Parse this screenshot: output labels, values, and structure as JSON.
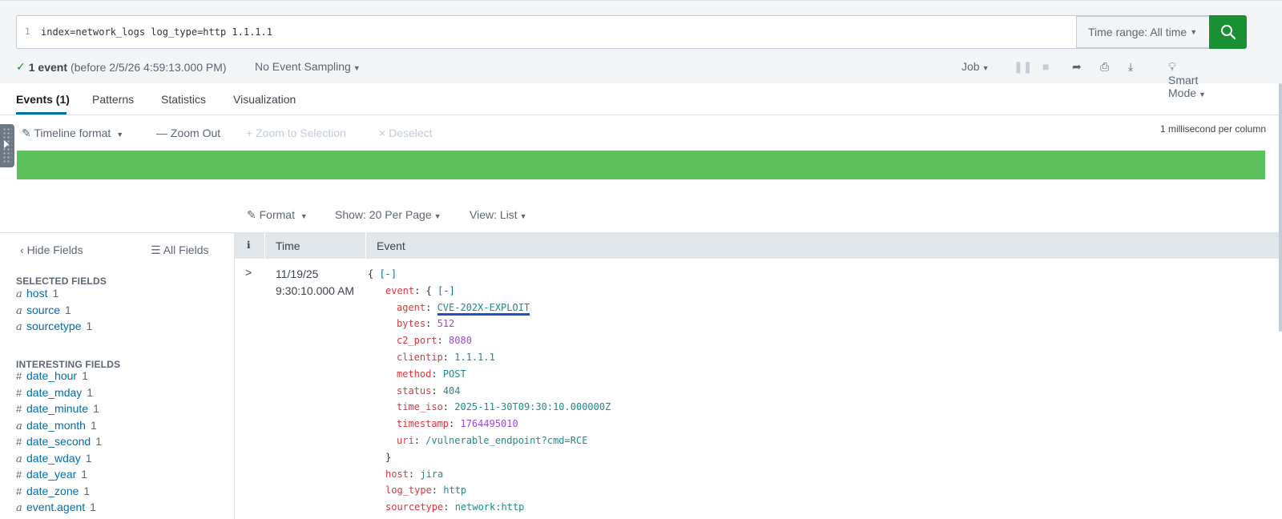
{
  "search": {
    "line_number": "1",
    "query": "index=network_logs log_type=http 1.1.1.1",
    "time_range_label": "Time range: All time"
  },
  "status": {
    "event_count": "1 event",
    "before_text": "(before 2/5/26 4:59:13.000 PM)",
    "sampling": "No Event Sampling"
  },
  "job_bar": {
    "job": "Job",
    "mode": "Smart Mode"
  },
  "tabs": [
    "Events (1)",
    "Patterns",
    "Statistics",
    "Visualization"
  ],
  "timeline": {
    "format": "Timeline format",
    "zoom_out": "Zoom Out",
    "zoom_selection": "+ Zoom to Selection",
    "deselect": "Deselect",
    "per_column": "1 millisecond per column",
    "bar_color": "#5cc05c"
  },
  "results_bar": {
    "format": "Format",
    "show": "Show: 20 Per Page",
    "view": "View: List"
  },
  "fields_panel": {
    "hide_fields": "Hide Fields",
    "all_fields": "All Fields",
    "selected_heading": "SELECTED FIELDS",
    "selected": [
      {
        "type": "a",
        "name": "host",
        "count": "1"
      },
      {
        "type": "a",
        "name": "source",
        "count": "1"
      },
      {
        "type": "a",
        "name": "sourcetype",
        "count": "1"
      }
    ],
    "interesting_heading": "INTERESTING FIELDS",
    "interesting": [
      {
        "type": "#",
        "name": "date_hour",
        "count": "1"
      },
      {
        "type": "#",
        "name": "date_mday",
        "count": "1"
      },
      {
        "type": "#",
        "name": "date_minute",
        "count": "1"
      },
      {
        "type": "a",
        "name": "date_month",
        "count": "1"
      },
      {
        "type": "#",
        "name": "date_second",
        "count": "1"
      },
      {
        "type": "a",
        "name": "date_wday",
        "count": "1"
      },
      {
        "type": "#",
        "name": "date_year",
        "count": "1"
      },
      {
        "type": "#",
        "name": "date_zone",
        "count": "1"
      },
      {
        "type": "a",
        "name": "event.agent",
        "count": "1"
      }
    ]
  },
  "events_table": {
    "col_info": "i",
    "col_time": "Time",
    "col_event": "Event",
    "time_date": "11/19/25",
    "time_clock": "9:30:10.000 AM",
    "collapse": "[-]",
    "event_key": "event",
    "fields": [
      {
        "key": "agent",
        "value": "CVE-202X-EXPLOIT",
        "kind": "agent"
      },
      {
        "key": "bytes",
        "value": "512",
        "kind": "num"
      },
      {
        "key": "c2_port",
        "value": "8080",
        "kind": "num"
      },
      {
        "key": "clientip",
        "value": "1.1.1.1",
        "kind": "str"
      },
      {
        "key": "method",
        "value": "POST",
        "kind": "str"
      },
      {
        "key": "status",
        "value": "404",
        "kind": "str"
      },
      {
        "key": "time_iso",
        "value": "2025-11-30T09:30:10.000000Z",
        "kind": "str"
      },
      {
        "key": "timestamp",
        "value": "1764495010",
        "kind": "num"
      },
      {
        "key": "uri",
        "value": "/vulnerable_endpoint?cmd=RCE",
        "kind": "str"
      }
    ],
    "top_fields": [
      {
        "key": "host",
        "value": "jira",
        "kind": "str"
      },
      {
        "key": "log_type",
        "value": "http",
        "kind": "str"
      },
      {
        "key": "sourcetype",
        "value": "network:http",
        "kind": "str"
      }
    ]
  },
  "colors": {
    "accent": "#1a9035",
    "link": "#006eaa",
    "json_key": "#d9363e",
    "json_string": "#1f8a8a",
    "json_number": "#9d49d8"
  }
}
